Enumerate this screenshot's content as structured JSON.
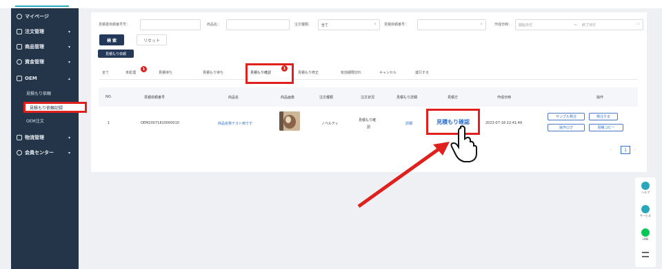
{
  "sidebar": {
    "items": [
      {
        "label": "マイページ"
      },
      {
        "label": "注文管理"
      },
      {
        "label": "商品管理"
      },
      {
        "label": "資金管理"
      },
      {
        "label": "OEM"
      },
      {
        "label": "物流管理"
      },
      {
        "label": "会員センター"
      }
    ],
    "oem_sub": [
      {
        "label": "見積もり依頼"
      },
      {
        "label": "見積もり依頼記録"
      },
      {
        "label": "OEM注文"
      }
    ]
  },
  "filters": {
    "quote_no_label": "見積書依頼番号号：",
    "product_label": "商品名：",
    "status_label": "注文種類：",
    "status_value": "全て",
    "quote_status_label": "見積依頼番号：",
    "date_label": "作成日時：",
    "date_start_placeholder": "開始日付",
    "date_sep": "～",
    "date_end_placeholder": "終了日付",
    "search_button": "検 索",
    "reset_button": "リセット",
    "request_button": "見積もり依頼"
  },
  "tabs": [
    {
      "label": "全て"
    },
    {
      "label": "未処理",
      "badge": "1"
    },
    {
      "label": "見積待ち"
    },
    {
      "label": "見積もり待ち"
    },
    {
      "label": "見積もり確認",
      "badge": "1"
    },
    {
      "label": "見積もり修正"
    },
    {
      "label": "有効期限切れ"
    },
    {
      "label": "キャンセル"
    },
    {
      "label": "進行する"
    }
  ],
  "table": {
    "headers": [
      "NO.",
      "見積依頼番号",
      "商品名",
      "商品画像",
      "注文種類",
      "注文状況",
      "見積もり詳細",
      "見積方",
      "作成日時",
      "操作"
    ],
    "row": {
      "no": "1",
      "quote_no": "OEM20071810000010",
      "product": "商品名称テスト用です",
      "order_type": "ノベルティ",
      "order_status_line1": "見積もり確",
      "order_status_line2": "認",
      "detail": "詳細",
      "quote_action": "見積もり確認",
      "created": "2023-07-18 22:41:49",
      "ops": [
        "サンプル発注",
        "発注する",
        "操作ログ",
        "見積コピー"
      ]
    }
  },
  "pagination": {
    "current": "1"
  },
  "float_bar": [
    {
      "label": "ヘルプ",
      "icon": "help-icon",
      "color": "#2aa7b8"
    },
    {
      "label": "サービス",
      "icon": "service-icon",
      "color": "#2aa7b8"
    },
    {
      "label": "LINE",
      "icon": "line-icon",
      "color": "#06c755"
    },
    {
      "label": "",
      "icon": "menu-icon",
      "color": "#666666"
    }
  ]
}
